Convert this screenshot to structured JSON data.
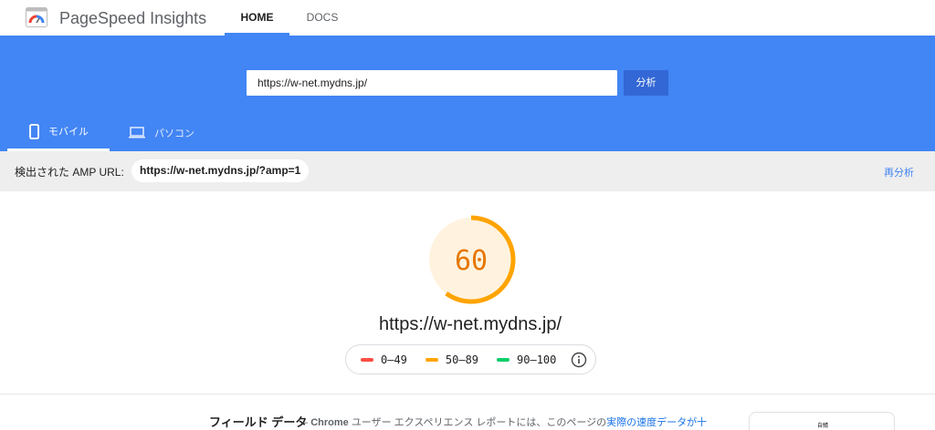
{
  "header": {
    "app_title": "PageSpeed Insights",
    "nav": [
      {
        "label": "HOME",
        "active": true
      },
      {
        "label": "DOCS",
        "active": false
      }
    ]
  },
  "search": {
    "url_value": "https://w-net.mydns.jp/",
    "analyze_label": "分析"
  },
  "device_tabs": [
    {
      "label": "モバイル",
      "icon": "smartphone-icon",
      "active": true
    },
    {
      "label": "パソコン",
      "icon": "laptop-icon",
      "active": false
    }
  ],
  "amp": {
    "label": "検出された AMP URL:",
    "url": "https://w-net.mydns.jp/?amp=1",
    "reanalyze_label": "再分析"
  },
  "score": {
    "value": 60,
    "fraction": 0.6,
    "color": "#ffa400",
    "tested_url": "https://w-net.mydns.jp/"
  },
  "legend": [
    {
      "range": "0–49",
      "color": "#ff4e42"
    },
    {
      "range": "50–89",
      "color": "#ffa400"
    },
    {
      "range": "90–100",
      "color": "#0cce6b"
    }
  ],
  "field_data": {
    "title": "フィールド データ",
    "dash": "–",
    "chrome": "Chrome",
    "desc_text": "ユーザー エクスペリエンス レポートには、このページの",
    "link_text": "実際の速度データが十",
    "thumbnail_label": "自鯖"
  },
  "colors": {
    "brand_blue": "#4285f4",
    "button_blue": "#3367d6",
    "average": "#ffa400",
    "fail": "#ff4e42",
    "pass": "#0cce6b"
  }
}
